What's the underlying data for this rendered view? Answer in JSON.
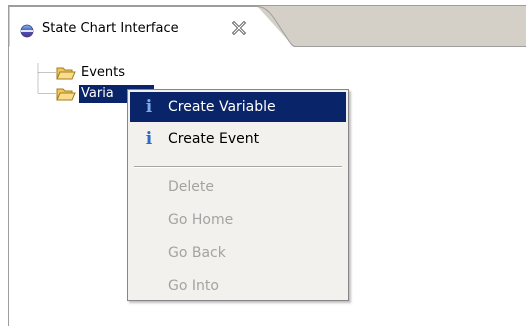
{
  "tab": {
    "title": "State Chart Interface",
    "icon": "state-chart-view-icon",
    "close_icon": "close-icon"
  },
  "tree": {
    "nodes": [
      {
        "label": "Events",
        "icon": "folder-icon",
        "selected": false
      },
      {
        "label": "Variables",
        "visible_label": "Varia",
        "icon": "folder-icon",
        "selected": true
      }
    ]
  },
  "context_menu": {
    "items": [
      {
        "label": "Create Variable",
        "icon": "info-icon",
        "enabled": true,
        "highlighted": true
      },
      {
        "label": "Create Event",
        "icon": "info-icon",
        "enabled": true,
        "highlighted": false
      },
      {
        "label": "Delete",
        "enabled": false
      },
      {
        "label": "Go Home",
        "enabled": false
      },
      {
        "label": "Go Back",
        "enabled": false
      },
      {
        "label": "Go Into",
        "enabled": false
      }
    ]
  },
  "colors": {
    "selection": "#0a246a",
    "tabstrip": "#d4d0c8",
    "menu_bg": "#f2f1ee",
    "disabled_text": "#a3a3a3",
    "info_icon": "#2d6bc7"
  }
}
